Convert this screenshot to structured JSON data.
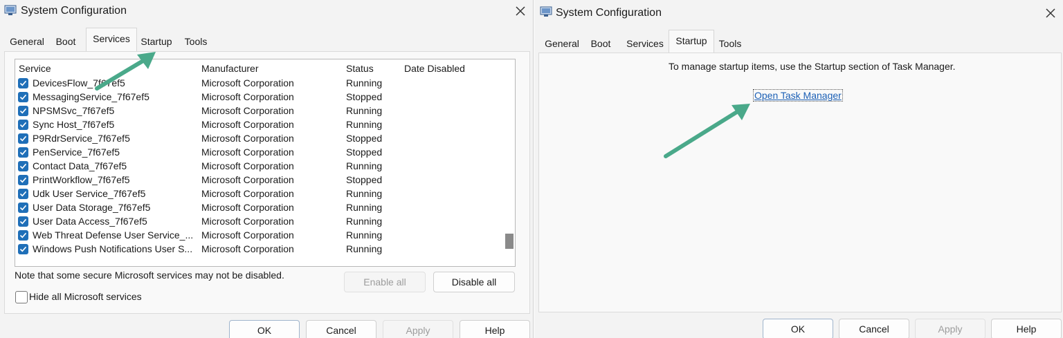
{
  "left_window": {
    "title": "System Configuration",
    "tabs": [
      "General",
      "Boot",
      "Services",
      "Startup",
      "Tools"
    ],
    "active_tab": "Services",
    "columns": [
      "Service",
      "Manufacturer",
      "Status",
      "Date Disabled"
    ],
    "rows": [
      {
        "service": "DevicesFlow_7f67ef5",
        "manufacturer": "Microsoft Corporation",
        "status": "Running",
        "date_disabled": "",
        "checked": true
      },
      {
        "service": "MessagingService_7f67ef5",
        "manufacturer": "Microsoft Corporation",
        "status": "Stopped",
        "date_disabled": "",
        "checked": true
      },
      {
        "service": "NPSMSvc_7f67ef5",
        "manufacturer": "Microsoft Corporation",
        "status": "Running",
        "date_disabled": "",
        "checked": true
      },
      {
        "service": "Sync Host_7f67ef5",
        "manufacturer": "Microsoft Corporation",
        "status": "Running",
        "date_disabled": "",
        "checked": true
      },
      {
        "service": "P9RdrService_7f67ef5",
        "manufacturer": "Microsoft Corporation",
        "status": "Stopped",
        "date_disabled": "",
        "checked": true
      },
      {
        "service": "PenService_7f67ef5",
        "manufacturer": "Microsoft Corporation",
        "status": "Stopped",
        "date_disabled": "",
        "checked": true
      },
      {
        "service": "Contact Data_7f67ef5",
        "manufacturer": "Microsoft Corporation",
        "status": "Running",
        "date_disabled": "",
        "checked": true
      },
      {
        "service": "PrintWorkflow_7f67ef5",
        "manufacturer": "Microsoft Corporation",
        "status": "Stopped",
        "date_disabled": "",
        "checked": true
      },
      {
        "service": "Udk User Service_7f67ef5",
        "manufacturer": "Microsoft Corporation",
        "status": "Running",
        "date_disabled": "",
        "checked": true
      },
      {
        "service": "User Data Storage_7f67ef5",
        "manufacturer": "Microsoft Corporation",
        "status": "Running",
        "date_disabled": "",
        "checked": true
      },
      {
        "service": "User Data Access_7f67ef5",
        "manufacturer": "Microsoft Corporation",
        "status": "Running",
        "date_disabled": "",
        "checked": true
      },
      {
        "service": "Web Threat Defense User Service_...",
        "manufacturer": "Microsoft Corporation",
        "status": "Running",
        "date_disabled": "",
        "checked": true
      },
      {
        "service": "Windows Push Notifications User S...",
        "manufacturer": "Microsoft Corporation",
        "status": "Running",
        "date_disabled": "",
        "checked": true
      }
    ],
    "note": "Note that some secure Microsoft services may not be disabled.",
    "enable_all": "Enable all",
    "disable_all": "Disable all",
    "hide_ms_label": "Hide all Microsoft services",
    "hide_ms_checked": false,
    "buttons": {
      "ok": "OK",
      "cancel": "Cancel",
      "apply": "Apply",
      "help": "Help"
    }
  },
  "right_window": {
    "title": "System Configuration",
    "tabs": [
      "General",
      "Boot",
      "Services",
      "Startup",
      "Tools"
    ],
    "active_tab": "Startup",
    "info_text": "To manage startup items, use the Startup section of Task Manager.",
    "link_text": "Open Task Manager",
    "buttons": {
      "ok": "OK",
      "cancel": "Cancel",
      "apply": "Apply",
      "help": "Help"
    }
  },
  "colors": {
    "arrow": "#4aa98a",
    "checkbox": "#1f6fb8",
    "link": "#1b5fb5"
  },
  "icons": [
    "system-config-icon",
    "close-icon",
    "checkmark-icon",
    "pointer-arrow"
  ]
}
